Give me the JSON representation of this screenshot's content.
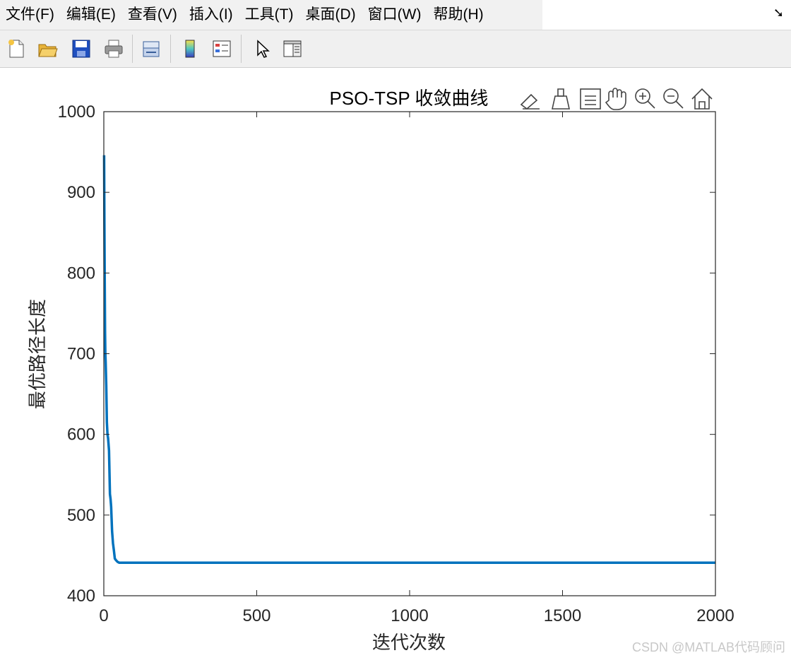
{
  "menu": {
    "items": [
      "文件(F)",
      "编辑(E)",
      "查看(V)",
      "插入(I)",
      "工具(T)",
      "桌面(D)",
      "窗口(W)",
      "帮助(H)"
    ],
    "corner_icon": "dock-arrow-icon"
  },
  "toolbar": {
    "buttons": [
      "new-figure-icon",
      "open-file-icon",
      "save-icon",
      "print-icon",
      "link-plot-icon",
      "insert-colorbar-icon",
      "insert-legend-icon",
      "edit-plot-pointer-icon",
      "property-inspector-icon"
    ]
  },
  "axes_toolbar": {
    "buttons": [
      "export-icon",
      "brush-icon",
      "data-tips-icon",
      "pan-hand-icon",
      "zoom-in-icon",
      "zoom-out-icon",
      "home-icon"
    ]
  },
  "chart_data": {
    "type": "line",
    "title": "PSO-TSP 收敛曲线",
    "xlabel": "迭代次数",
    "ylabel": "最优路径长度",
    "xlim": [
      0,
      2000
    ],
    "ylim": [
      400,
      1000
    ],
    "xticks": [
      "0",
      "500",
      "1000",
      "1500",
      "2000"
    ],
    "yticks": [
      "400",
      "500",
      "600",
      "700",
      "800",
      "900",
      "1000"
    ],
    "grid": true,
    "series": [
      {
        "color": "#0072bd",
        "x": [
          1,
          2,
          3,
          4,
          5,
          6,
          8,
          10,
          12,
          14,
          17,
          20,
          22,
          24,
          27,
          30,
          33,
          36,
          40,
          45,
          50,
          60,
          80,
          100,
          500,
          1000,
          1500,
          2000
        ],
        "y": [
          946,
          860,
          790,
          728,
          700,
          690,
          660,
          615,
          600,
          595,
          580,
          526,
          520,
          510,
          480,
          465,
          456,
          446,
          444,
          442,
          441,
          441,
          441,
          441,
          441,
          441,
          441,
          441
        ]
      }
    ]
  },
  "watermark": "CSDN @MATLAB代码顾问"
}
